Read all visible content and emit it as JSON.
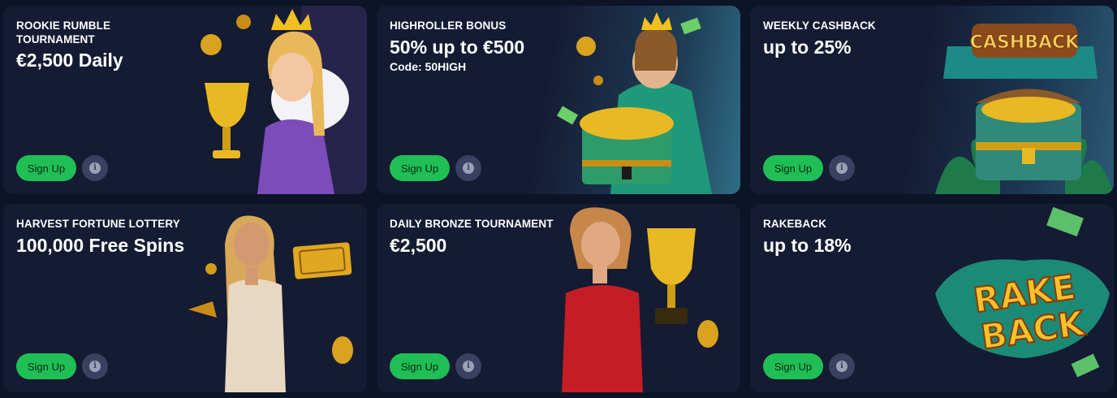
{
  "promos": [
    {
      "subtitle": "ROOKIE RUMBLE TOURNAMENT",
      "title": "€2,500 Daily",
      "code": "",
      "signup": "Sign Up",
      "info": "i",
      "art": "princess-trophy-illustration"
    },
    {
      "subtitle": "HIGHROLLER BONUS",
      "title": "50% up to €500",
      "code": "Code: 50HIGH",
      "signup": "Sign Up",
      "info": "i",
      "art": "king-treasure-chest-illustration"
    },
    {
      "subtitle": "WEEKLY CASHBACK",
      "title": "up to 25%",
      "code": "",
      "signup": "Sign Up",
      "info": "i",
      "art": "cashback-chest-illustration"
    },
    {
      "subtitle": "HARVEST FORTUNE LOTTERY",
      "title": "100,000 Free Spins",
      "code": "",
      "signup": "Sign Up",
      "info": "i",
      "art": "woman-golden-ticket-illustration"
    },
    {
      "subtitle": "DAILY BRONZE TOURNAMENT",
      "title": "€2,500",
      "code": "",
      "signup": "Sign Up",
      "info": "i",
      "art": "woman-trophy-illustration"
    },
    {
      "subtitle": "RAKEBACK",
      "title": "up to 18%",
      "code": "",
      "signup": "Sign Up",
      "info": "i",
      "art": "rakeback-logo-illustration"
    }
  ],
  "art_text": {
    "cashback": "CASHBACK",
    "rake": "RAKE",
    "back": "BACK"
  },
  "colors": {
    "background": "#0d1428",
    "card": "#141b33",
    "signup_green": "#1fbf55",
    "info_gray": "#3a4160",
    "gold": "#e8b923"
  }
}
